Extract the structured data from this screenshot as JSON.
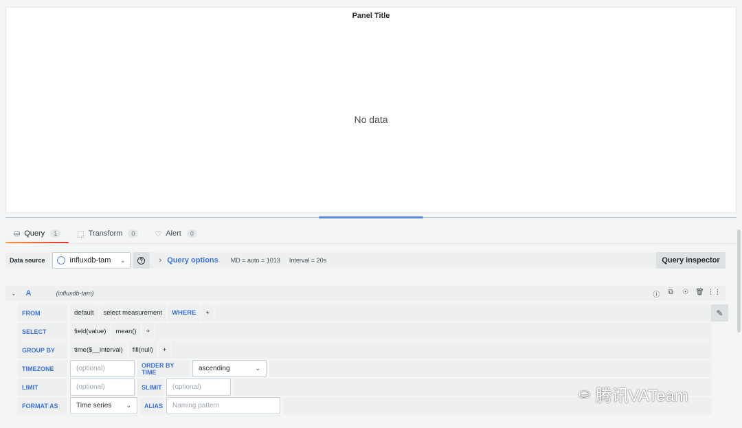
{
  "panel": {
    "title": "Panel Title",
    "empty_text": "No data"
  },
  "tabs": [
    {
      "label": "Query",
      "count": "1",
      "icon": "database-icon",
      "active": true
    },
    {
      "label": "Transform",
      "count": "0",
      "icon": "transform-icon"
    },
    {
      "label": "Alert",
      "count": "0",
      "icon": "bell-icon"
    }
  ],
  "datasource": {
    "label": "Data source",
    "selected": "influxdb-tam",
    "query_options_label": "Query options",
    "md": "MD = auto = 1013",
    "interval": "Interval = 20s",
    "inspector_label": "Query inspector"
  },
  "query": {
    "letter": "A",
    "datasource": "(influxdb-tam)",
    "from_kw": "FROM",
    "from_db": "default",
    "from_measurement": "select measurement",
    "where_kw": "WHERE",
    "plus": "+",
    "select_kw": "SELECT",
    "select_field": "field(value)",
    "select_fn": "mean()",
    "groupby_kw": "GROUP BY",
    "groupby_time": "time($__interval)",
    "groupby_fill": "fill(null)",
    "timezone_kw": "TIMEZONE",
    "timezone_placeholder": "(optional)",
    "orderby_kw": "ORDER BY TIME",
    "orderby_value": "ascending",
    "limit_kw": "LIMIT",
    "limit_placeholder": "(optional)",
    "slimit_kw": "SLIMIT",
    "slimit_placeholder": "(optional)",
    "format_kw": "FORMAT AS",
    "format_value": "Time series",
    "alias_kw": "ALIAS",
    "alias_placeholder": "Naming pattern"
  },
  "watermark": "腾讯VATeam",
  "colors": {
    "accent": "#3d71d9",
    "tab_underline_start": "#f99e3a",
    "tab_underline_end": "#e12e3a"
  }
}
